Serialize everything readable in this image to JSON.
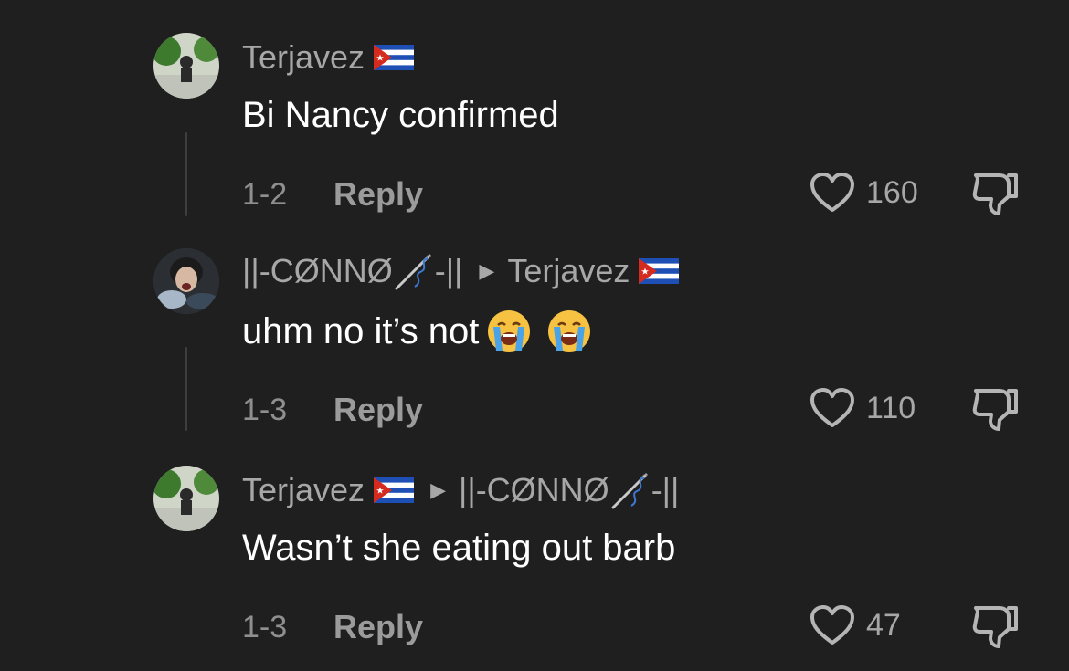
{
  "comments": [
    {
      "author": "Terjavez",
      "author_flag": "cuba-flag",
      "body": "Bi Nancy confirmed",
      "date": "1-2",
      "reply_label": "Reply",
      "likes": "160"
    },
    {
      "author": "||-CØNNØ",
      "author_suffix": "-||",
      "reply_to": "Terjavez",
      "body": "uhm no it’s not",
      "date": "1-3",
      "reply_label": "Reply",
      "likes": "110"
    },
    {
      "author": "Terjavez",
      "reply_to": "||-CØNNØ",
      "reply_to_suffix": "-||",
      "body": "Wasn’t she eating out barb",
      "date": "1-3",
      "reply_label": "Reply",
      "likes": "47"
    }
  ],
  "colors": {
    "background": "#1f1f1f",
    "muted_text": "#a7a7a7",
    "primary_text": "#ffffff"
  }
}
